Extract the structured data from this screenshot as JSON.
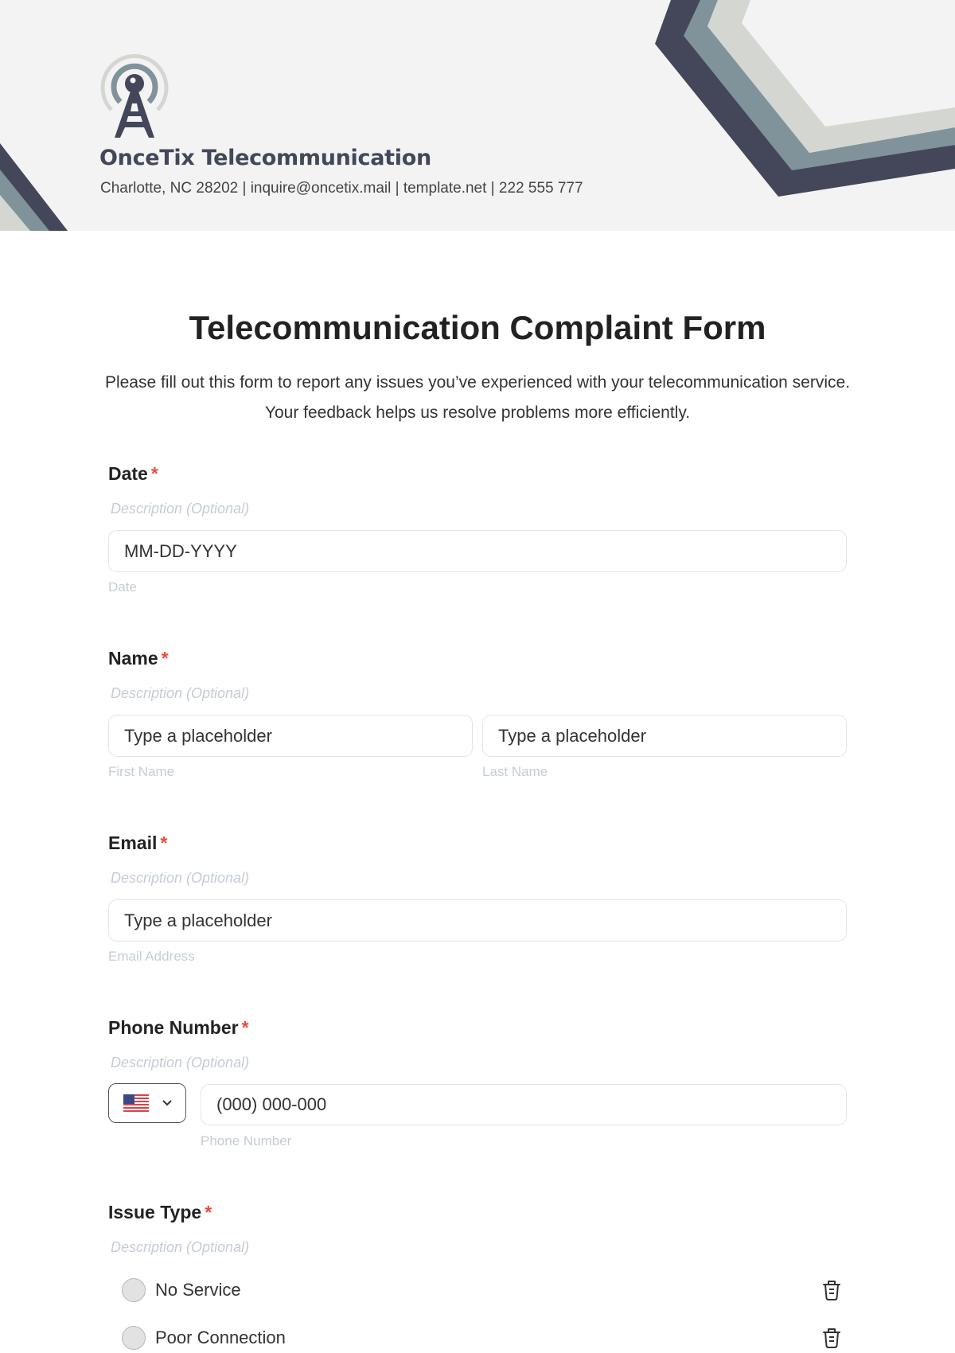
{
  "company": {
    "name": "OnceTix Telecommunication",
    "info": "Charlotte, NC 28202 | inquire@oncetix.mail | template.net | 222 555 777"
  },
  "brand_colors": {
    "dark": "#434759",
    "slate": "#80939a",
    "light": "#d4d7d1",
    "header_bg": "#f3f3f3",
    "required": "#ef4a3c"
  },
  "form": {
    "title": "Telecommunication Complaint Form",
    "intro": "Please fill out this form to report any issues you’ve experienced with your telecommunication service. Your feedback helps us resolve problems more efficiently.",
    "required_mark": "*",
    "fields": {
      "date": {
        "label": "Date",
        "description": "Description (Optional)",
        "placeholder": "MM-DD-YYYY",
        "sub_label": "Date"
      },
      "name": {
        "label": "Name",
        "description": "Description (Optional)",
        "first_placeholder": "Type a placeholder",
        "first_sub_label": "First Name",
        "last_placeholder": "Type a placeholder",
        "last_sub_label": "Last Name"
      },
      "email": {
        "label": "Email",
        "description": "Description (Optional)",
        "placeholder": "Type a placeholder",
        "sub_label": "Email Address"
      },
      "phone": {
        "label": "Phone Number",
        "description": "Description (Optional)",
        "country_icon": "us-flag-icon",
        "placeholder": "(000) 000-000",
        "sub_label": "Phone Number"
      },
      "issue_type": {
        "label": "Issue Type",
        "description": "Description (Optional)",
        "options": [
          {
            "label": "No Service",
            "icon": "trash-icon"
          },
          {
            "label": "Poor Connection",
            "icon": "trash-icon"
          }
        ]
      }
    }
  }
}
